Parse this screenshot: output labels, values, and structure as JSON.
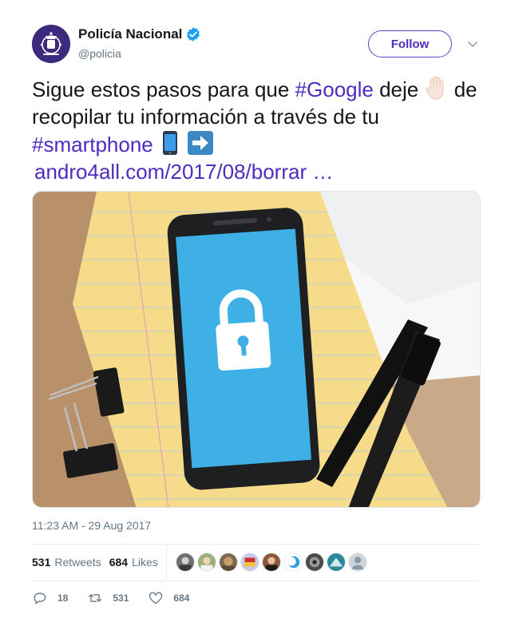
{
  "user": {
    "name": "Policía Nacional",
    "handle": "@policia",
    "follow_label": "Follow"
  },
  "tweet": {
    "text_part1": "Sigue estos pasos para que ",
    "hashtag1": "#Google",
    "text_part2": " deje ",
    "text_part3": " de recopilar tu información a través de tu ",
    "hashtag2": "#smartphone",
    "link": "andro4all.com/2017/08/borrar …",
    "timestamp": "11:23 AM - 29 Aug 2017"
  },
  "stats": {
    "retweets_count": "531",
    "retweets_label": "Retweets",
    "likes_count": "684",
    "likes_label": "Likes"
  },
  "actions": {
    "reply_count": "18",
    "retweet_count": "531",
    "like_count": "684"
  },
  "colors": {
    "accent": "#4d2cc0",
    "verified": "#1da1f2",
    "avatar_bg": "#3b2a7e"
  },
  "icons": {
    "verified": "verified-badge-icon",
    "caret": "chevron-down-icon",
    "reply": "reply-icon",
    "retweet": "retweet-icon",
    "like": "heart-icon",
    "hand_emoji": "raised-hand-emoji",
    "phone_emoji": "mobile-phone-emoji",
    "arrow_emoji": "right-arrow-emoji"
  }
}
